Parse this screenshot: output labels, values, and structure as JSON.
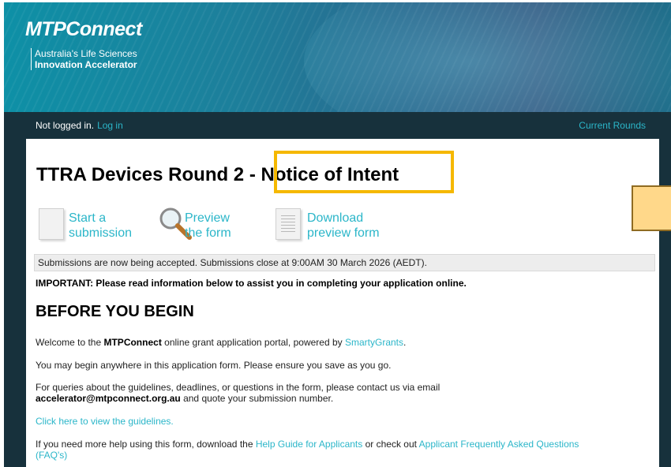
{
  "header": {
    "logo": "MTPConnect",
    "tagline_line1": "Australia's Life Sciences",
    "tagline_line2": "Innovation Accelerator"
  },
  "nav": {
    "status": "Not logged in.",
    "login_link": "Log in",
    "rounds_link": "Current Rounds"
  },
  "page": {
    "title_part1": "TTRA Devices Round 2 ",
    "title_part2": "- Notice of Intent"
  },
  "actions": [
    {
      "line1": "Start a",
      "line2": "submission",
      "icon": "document-icon"
    },
    {
      "line1": "Preview",
      "line2": "the form",
      "icon": "magnifier-icon"
    },
    {
      "line1": "Download",
      "line2": "preview form",
      "icon": "document-lines-icon"
    }
  ],
  "notice": "Submissions are now being accepted. Submissions close at 9:00AM 30 March 2026 (AEDT).",
  "important": "IMPORTANT: Please read information below to assist you in completing your application online.",
  "section_title": "BEFORE YOU BEGIN",
  "welcome": {
    "pre": "Welcome to the ",
    "brand": "MTPConnect",
    "mid": " online grant application portal, powered by ",
    "link": "SmartyGrants",
    "post": "."
  },
  "begin_text": "You may begin anywhere in this application form. Please ensure you save as you go.",
  "queries": {
    "line1": "For queries about the guidelines, deadlines, or questions in the form, please contact us via email",
    "email": "accelerator@mtpconnect.org.au",
    "line2_post": " and quote your submission number."
  },
  "guidelines_link": "Click here to view the guidelines.",
  "help": {
    "pre": "If you need more help using this form, download the ",
    "guide_link": "Help Guide for Applicants",
    "mid": " or check out ",
    "faq_link_line1": "Applicant Frequently Asked Questions",
    "faq_link_line2": "(FAQ's)"
  },
  "colors": {
    "link": "#2bb6c9",
    "nav_bg": "#17313c",
    "highlight": "#f5b800"
  }
}
